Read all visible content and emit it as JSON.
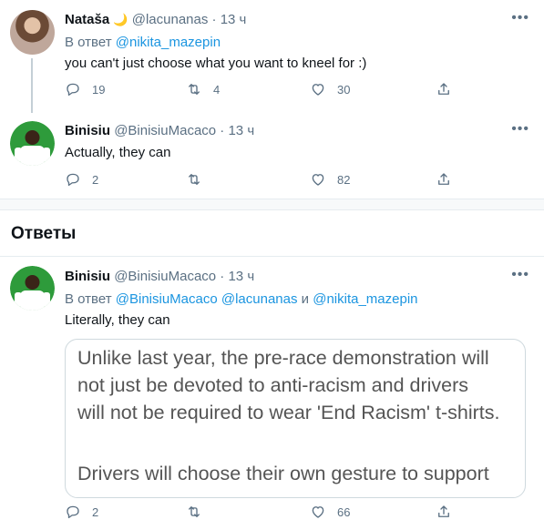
{
  "tweets": [
    {
      "name": "Nataša",
      "name_emoji": "🌙",
      "handle": "@lacunanas",
      "sep": "·",
      "time": "13 ч",
      "reply_prefix": "В ответ",
      "reply_mentions": [
        "@nikita_mazepin"
      ],
      "text": "you can't just choose what you want to kneel for :)",
      "replies": "19",
      "retweets": "4",
      "likes": "30"
    },
    {
      "name": "Binisiu",
      "handle": "@BinisiuMacaco",
      "sep": "·",
      "time": "13 ч",
      "text": "Actually, they can",
      "replies": "2",
      "retweets": "",
      "likes": "82"
    }
  ],
  "section_title": "Ответы",
  "reply": {
    "name": "Binisiu",
    "handle": "@BinisiuMacaco",
    "sep": "·",
    "time": "13 ч",
    "reply_prefix": "В ответ",
    "mention1": "@BinisiuMacaco",
    "mention2": "@lacunanas",
    "conj": "и",
    "mention3": "@nikita_mazepin",
    "text": "Literally, they can",
    "media_lines": [
      "Unlike last year, the pre-race demonstration will",
      "not just be devoted to anti-racism and drivers",
      "will not be required to wear 'End Racism' t-shirts.",
      "",
      "Drivers will choose their own gesture to support"
    ],
    "replies": "2",
    "retweets": "",
    "likes": "66"
  },
  "icons": {
    "more": "more-icon",
    "reply": "reply-icon",
    "retweet": "retweet-icon",
    "like": "heart-icon",
    "share": "share-icon"
  },
  "colors": {
    "link": "#1b95e0",
    "muted": "#5b7083",
    "divider": "#e6ecf0"
  }
}
